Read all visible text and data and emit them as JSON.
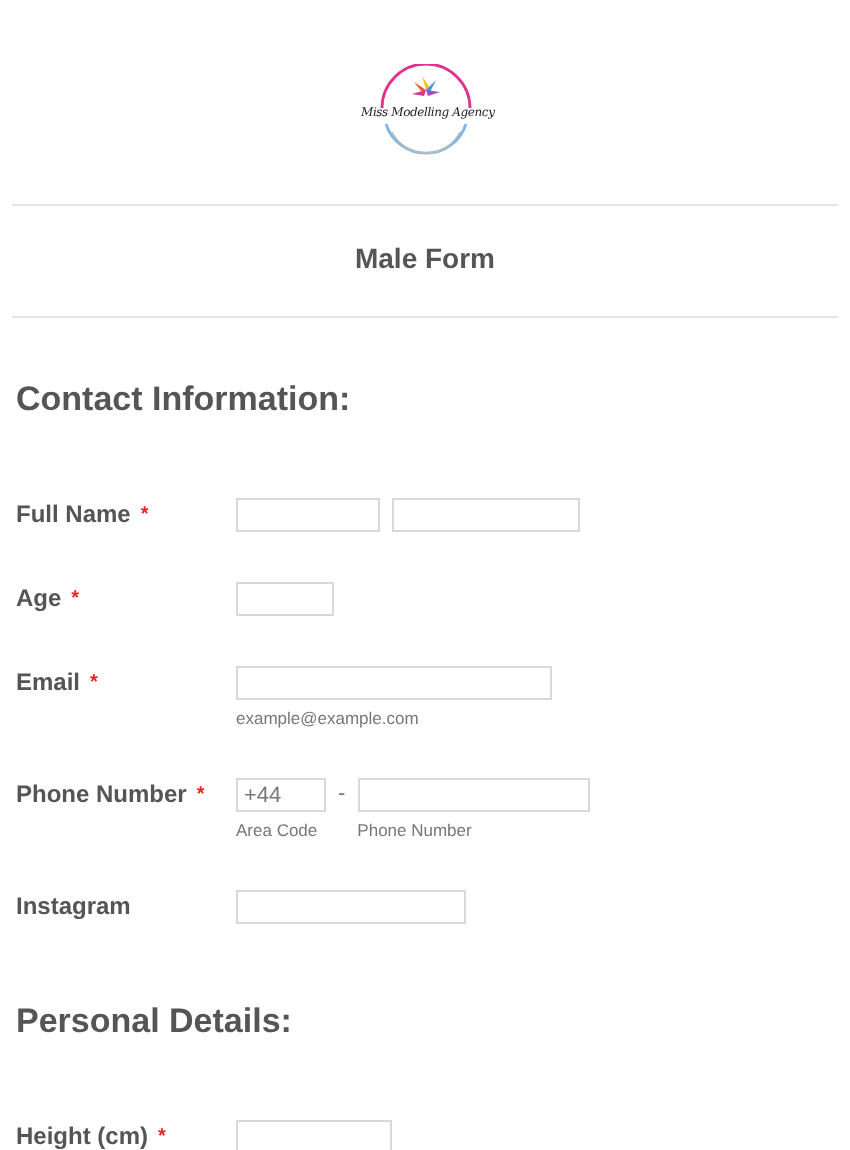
{
  "logo": {
    "text": "Miss Modelling Agency"
  },
  "form_title": "Male Form",
  "sections": [
    {
      "heading": "Contact Information:",
      "fields": [
        {
          "kind": "name",
          "label": "Full Name",
          "required_mark": "*"
        },
        {
          "kind": "short",
          "label": "Age",
          "required_mark": "*"
        },
        {
          "kind": "email",
          "label": "Email",
          "required_mark": "*",
          "inputs": [
            {
              "sublabel": "example@example.com"
            }
          ]
        },
        {
          "kind": "phone",
          "label": "Phone Number",
          "required_mark": "*",
          "separator": "-",
          "inputs": [
            {
              "value": "+44",
              "sublabel": "Area Code"
            },
            {
              "sublabel": "Phone Number"
            }
          ]
        },
        {
          "kind": "text",
          "label": "Instagram"
        }
      ]
    },
    {
      "heading": "Personal Details:",
      "fields": [
        {
          "kind": "number",
          "label": "Height (cm)",
          "required_mark": "*"
        }
      ]
    }
  ]
}
